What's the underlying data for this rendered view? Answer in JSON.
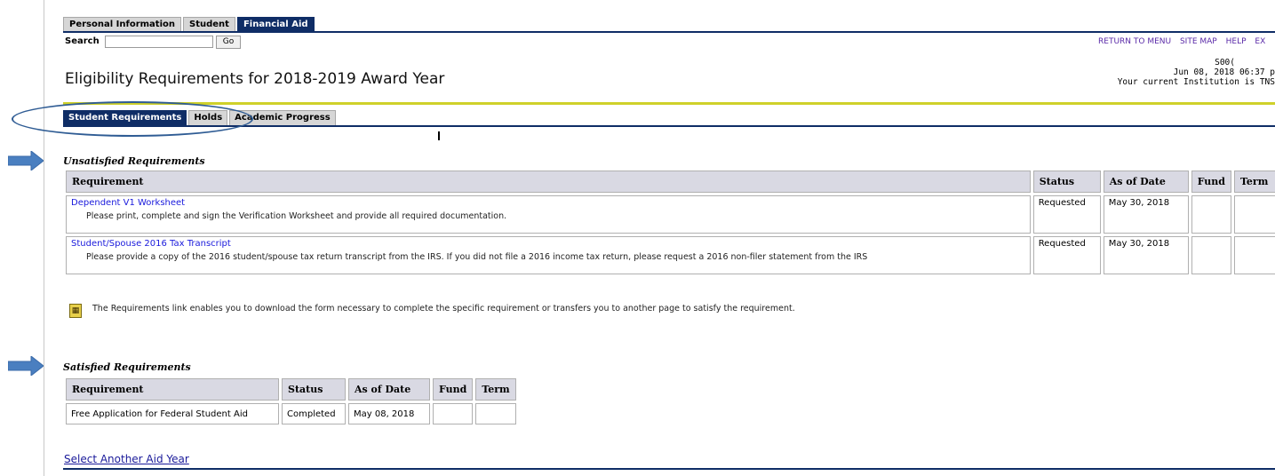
{
  "top_tabs": [
    "Personal Information",
    "Student",
    "Financial Aid"
  ],
  "search": {
    "label": "Search",
    "value": "",
    "go_label": "Go"
  },
  "top_links": [
    "RETURN TO MENU",
    "SITE MAP",
    "HELP",
    "EX"
  ],
  "header_info": {
    "id": "S00(",
    "datetime": "Jun 08, 2018 06:37 p",
    "institution": "Your current Institution is TNS"
  },
  "page_title": "Eligibility Requirements for 2018-2019 Award Year",
  "sub_tabs": [
    "Student Requirements",
    "Holds",
    "Academic Progress"
  ],
  "unsatisfied": {
    "title": "Unsatisfied Requirements",
    "headers": [
      "Requirement",
      "Status",
      "As of Date",
      "Fund",
      "Term"
    ],
    "rows": [
      {
        "name": "Dependent V1 Worksheet",
        "desc": "Please print, complete and sign the Verification Worksheet and provide all required documentation.",
        "status": "Requested",
        "date": "May 30, 2018",
        "fund": "",
        "term": ""
      },
      {
        "name": "Student/Spouse 2016 Tax Transcript",
        "desc": "Please provide a copy of the 2016 student/spouse tax return transcript from the IRS. If you did not file a 2016 income tax return, please request a 2016 non-filer statement from the IRS",
        "status": "Requested",
        "date": "May 30, 2018",
        "fund": "",
        "term": ""
      }
    ]
  },
  "note": "The Requirements link enables you to download the form necessary to complete the specific requirement or transfers you to another page to satisfy the requirement.",
  "satisfied": {
    "title": "Satisfied Requirements",
    "headers": [
      "Requirement",
      "Status",
      "As of Date",
      "Fund",
      "Term"
    ],
    "rows": [
      {
        "name": "Free Application for Federal Student Aid",
        "status": "Completed",
        "date": "May 08, 2018",
        "fund": "",
        "term": ""
      }
    ]
  },
  "select_link": "Select Another Aid Year",
  "colors": {
    "navy": "#0f2d66",
    "gold": "#cfd12a",
    "link": "#1a1adc",
    "annotation": "#4a7fc0"
  }
}
